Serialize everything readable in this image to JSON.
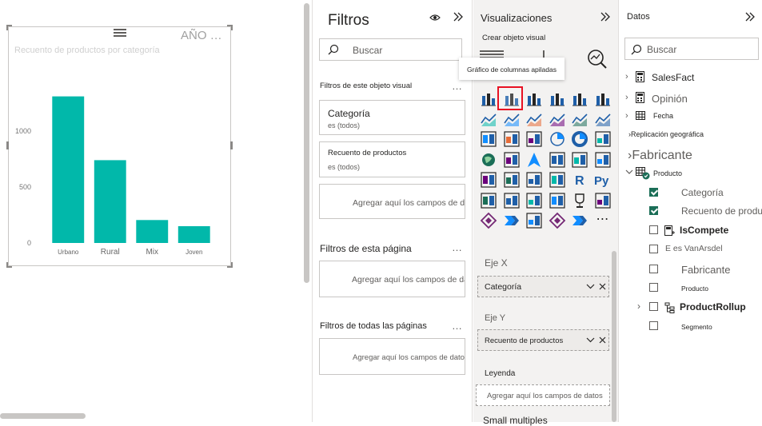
{
  "canvas": {
    "visual": {
      "anio_label": "AÑO …"
    }
  },
  "chart_data": {
    "type": "bar",
    "title": "Recuento de productos por categoría",
    "categories": [
      "Urbano",
      "Rural",
      "Mix",
      "Joven"
    ],
    "values": [
      1310,
      740,
      205,
      150
    ],
    "ylim": [
      0,
      1500
    ],
    "yticks": [
      0,
      500,
      1000
    ],
    "ytick_labels": [
      "0",
      "500",
      "1000"
    ],
    "bar_color": "#01b8aa",
    "grid": false
  },
  "filters": {
    "title": "Filtros",
    "search_placeholder": "Buscar",
    "visual_section": "Filtros de este objeto visual",
    "cards": [
      {
        "name": "Categoría",
        "value": "es (todos)"
      },
      {
        "name": "Recuento de productos",
        "value": "es (todos)"
      }
    ],
    "add_here": "Agregar aquí los campos de datos",
    "page_section": "Filtros de esta página",
    "all_pages_section": "Filtros de todas las páginas",
    "more": "…"
  },
  "viz": {
    "title": "Visualizaciones",
    "subtitle": "Crear objeto visual",
    "tooltip": "Gráfico de columnas apiladas",
    "more_icons": "⋯",
    "x_axis_label": "Eje X",
    "x_axis_field": "Categoría",
    "y_axis_label": "Eje Y",
    "y_axis_field": "Recuento de productos",
    "legend_label": "Leyenda",
    "legend_placeholder": "Agregar aquí los campos de datos",
    "small_multiples": "Small multiples",
    "accent_color": "#e81123"
  },
  "data": {
    "title": "Datos",
    "search_placeholder": "Buscar",
    "tables": [
      {
        "name": "SalesFact",
        "icon": "calculator-icon"
      },
      {
        "name": "Opinión",
        "icon": "calculator-icon"
      },
      {
        "name": "Fecha",
        "icon": "table-icon"
      }
    ],
    "geo": "Replicación geográfica",
    "fabricante": "Fabricante",
    "producto_table": "Producto",
    "fields": [
      {
        "name": "Categoría",
        "checked": true
      },
      {
        "name": "Recuento de productos",
        "checked": true
      },
      {
        "name": "IsCompete",
        "checked": false
      },
      {
        "name": "E es VanArsdel",
        "checked": false
      },
      {
        "name": "Fabricante",
        "checked": false
      },
      {
        "name": "Producto",
        "checked": false
      },
      {
        "name": "ProductRollup",
        "checked": false
      },
      {
        "name": "Segmento",
        "checked": false
      }
    ]
  }
}
